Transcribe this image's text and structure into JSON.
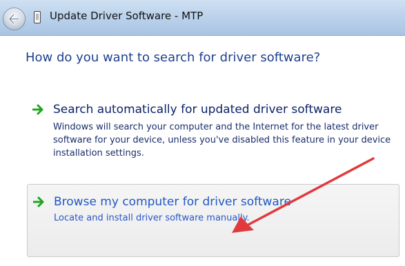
{
  "titlebar": {
    "title": "Update Driver Software - MTP",
    "back_icon": "back-arrow-icon",
    "window_icon": "device-icon"
  },
  "main": {
    "heading": "How do you want to search for driver software?",
    "options": [
      {
        "title": "Search automatically for updated driver software",
        "description": "Windows will search your computer and the Internet for the latest driver software for your device, unless you've disabled this feature in your device installation settings.",
        "icon": "green-arrow-icon"
      },
      {
        "title": "Browse my computer for driver software",
        "description": "Locate and install driver software manually.",
        "icon": "green-arrow-icon"
      }
    ]
  },
  "colors": {
    "heading": "#1e3f8f",
    "link_title": "#1f57c3",
    "green_arrow": "#1ea51e",
    "annotation_arrow": "#e03a3e"
  }
}
